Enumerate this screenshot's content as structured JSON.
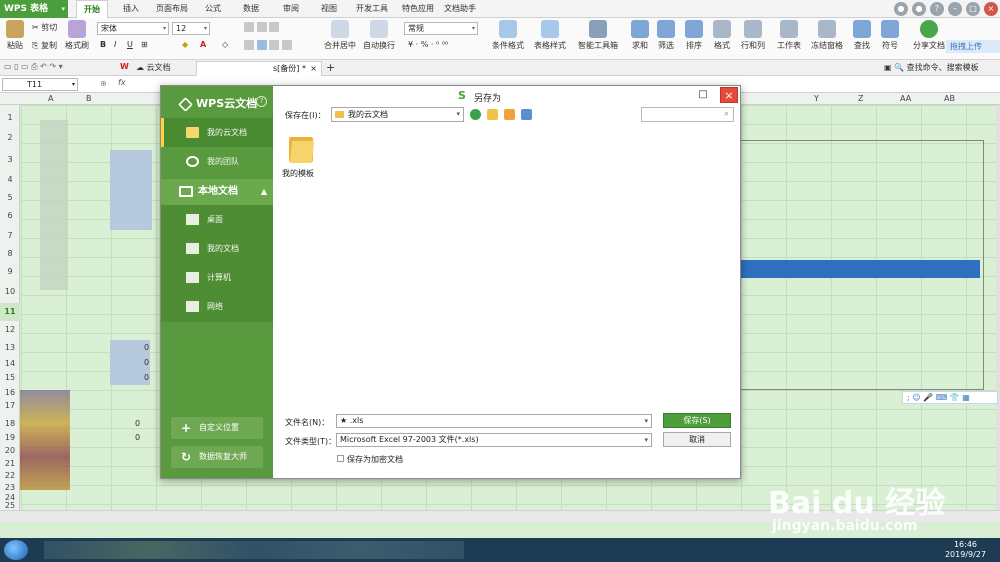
{
  "app": {
    "name": "WPS 表格"
  },
  "menu": [
    "开始",
    "插入",
    "页面布局",
    "公式",
    "数据",
    "审阅",
    "视图",
    "开发工具",
    "特色应用",
    "文档助手"
  ],
  "ribbon": {
    "paste": "粘贴",
    "cut": "剪切",
    "copy": "复制",
    "format_painter": "格式刷",
    "font_name": "宋体",
    "font_size": "12",
    "merge_center": "合并居中",
    "wrap_text": "自动换行",
    "number_format": "常规",
    "conditional_format": "条件格式",
    "table_style": "表格样式",
    "smart_toolbox": "智能工具箱",
    "sum": "求和",
    "filter": "筛选",
    "sort": "排序",
    "format": "格式",
    "rows_cols": "行和列",
    "worksheet": "工作表",
    "freeze": "冻结窗格",
    "find": "查找",
    "symbol": "符号",
    "share": "分享文档",
    "upload": "拖拽上传"
  },
  "tabs": {
    "cloud_docs": "云文档",
    "document": "s[备份] *",
    "search_hint": "查找命令、搜索模板"
  },
  "formula": {
    "cell_ref": "T11",
    "fx": "fx"
  },
  "columns": [
    "A",
    "B",
    "Y",
    "Z",
    "AA",
    "AB"
  ],
  "rows": [
    "1",
    "2",
    "3",
    "4",
    "5",
    "6",
    "7",
    "8",
    "9",
    "10",
    "11",
    "12",
    "13",
    "14",
    "15",
    "16",
    "17",
    "18",
    "19",
    "20",
    "21",
    "22",
    "23",
    "24",
    "25"
  ],
  "cells": {
    "a": "0",
    "b": "0",
    "c": "0",
    "d": "0",
    "e": "0"
  },
  "dialog": {
    "title": "另存为",
    "brand": "WPS云文档",
    "help": "?",
    "sidebar": {
      "my_cloud": "我的云文档",
      "my_team": "我的团队",
      "local_docs": "本地文档",
      "desktop": "桌面",
      "my_documents": "我的文档",
      "computer": "计算机",
      "network": "网络",
      "custom_location": "自定义位置",
      "data_recovery": "数据恢复大师"
    },
    "save_in_label": "保存在(I)：",
    "save_in_value": "我的云文档",
    "folder_item": "我的模板",
    "filename_label": "文件名(N)：",
    "filename_value": "★          .xls",
    "filetype_label": "文件类型(T)：",
    "filetype_value": "Microsoft Excel 97-2003 文件(*.xls)",
    "encrypt_label": "保存为加密文档",
    "save_button": "保存(S)",
    "cancel_button": "取消"
  },
  "taskbar": {
    "time": "16:46",
    "date": "2019/9/27"
  },
  "watermark": {
    "brand": "Bai  du 经验",
    "url": "jingyan.baidu.com"
  },
  "colors": {
    "accent": "#4d9e3a",
    "sidebar": "#5a9a3f",
    "close": "#e54b3b",
    "sheet": "#daf0d4"
  }
}
